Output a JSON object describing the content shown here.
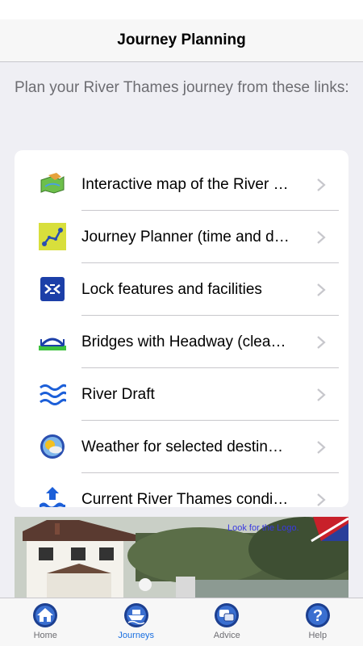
{
  "header": {
    "title": "Journey Planning"
  },
  "intro": "Plan your River Thames journey from these links:",
  "menu": [
    {
      "label": "Interactive map of the River …",
      "icon": "map-icon"
    },
    {
      "label": "Journey Planner (time and d…",
      "icon": "route-icon"
    },
    {
      "label": "Lock features and facilities",
      "icon": "lock-icon"
    },
    {
      "label": "Bridges with Headway (clea…",
      "icon": "bridge-icon"
    },
    {
      "label": "River Draft",
      "icon": "waves-icon"
    },
    {
      "label": "Weather for selected destin…",
      "icon": "weather-icon"
    },
    {
      "label": "Current River Thames condi…",
      "icon": "river-conditions-icon"
    }
  ],
  "banner": {
    "text": "Look for the Logo."
  },
  "tabs": [
    {
      "label": "Home",
      "icon": "home-icon"
    },
    {
      "label": "Journeys",
      "icon": "boat-icon",
      "active": true
    },
    {
      "label": "Advice",
      "icon": "chat-icon"
    },
    {
      "label": "Help",
      "icon": "help-icon"
    }
  ],
  "colors": {
    "accent": "#1a6fe0",
    "separator": "#c8c7cc",
    "background": "#efeff4"
  }
}
